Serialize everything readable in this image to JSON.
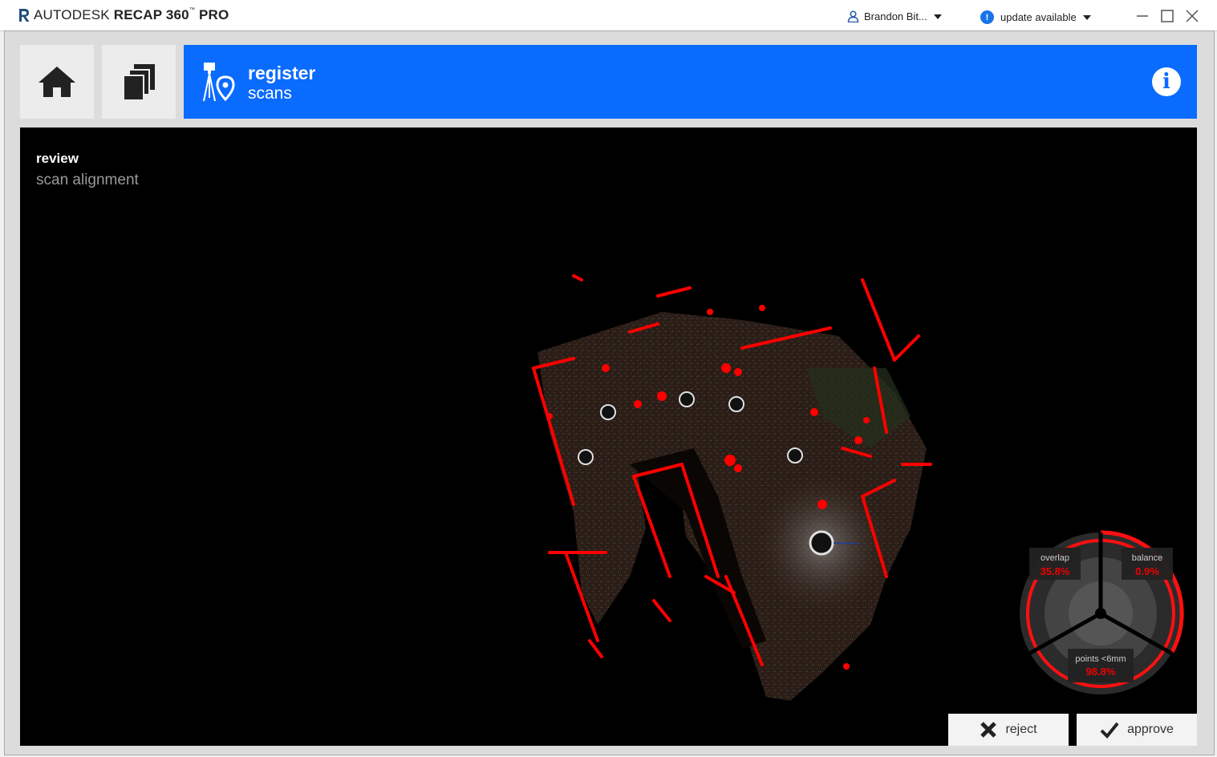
{
  "app": {
    "brand_light": "AUTODESK",
    "brand_bold": "RECAP 360",
    "brand_tm": "™",
    "brand_pro": "PRO"
  },
  "header": {
    "user_name": "Brandon Bit...",
    "update_label": "update available"
  },
  "banner": {
    "title": "register",
    "subtitle": "scans"
  },
  "viewport": {
    "heading": "review",
    "subheading": "scan alignment"
  },
  "gauge": {
    "overlap_label": "overlap",
    "overlap_value": "35.8%",
    "balance_label": "balance",
    "balance_value": "0.9%",
    "points_label": "points <6mm",
    "points_value": "98.8%"
  },
  "actions": {
    "reject_label": "reject",
    "approve_label": "approve"
  },
  "colors": {
    "accent": "#0a6bff",
    "alert": "#e00000"
  }
}
